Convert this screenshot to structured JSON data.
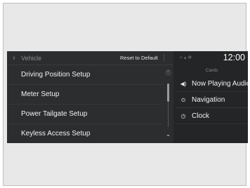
{
  "header": {
    "back_icon": "chevron-left-icon",
    "breadcrumb": "Vehicle",
    "reset_label": "Reset to Default"
  },
  "menu": {
    "items": [
      {
        "label": "Driving Position Setup"
      },
      {
        "label": "Meter Setup"
      },
      {
        "label": "Power Tailgate Setup"
      },
      {
        "label": "Keyless Access Setup"
      }
    ]
  },
  "status": {
    "time": "12:00",
    "icons": [
      "wifi-icon",
      "signal-icon",
      "bluetooth-icon"
    ]
  },
  "cards": {
    "title": "Cards",
    "items": [
      {
        "label": "Now Playing Audio",
        "icon": "speaker-icon"
      },
      {
        "label": "Navigation",
        "icon": "navigation-icon"
      },
      {
        "label": "Clock",
        "icon": "clock-icon"
      }
    ]
  },
  "colors": {
    "background": "#242526",
    "text": "#f2f2f2",
    "muted": "#8c8c8c"
  }
}
